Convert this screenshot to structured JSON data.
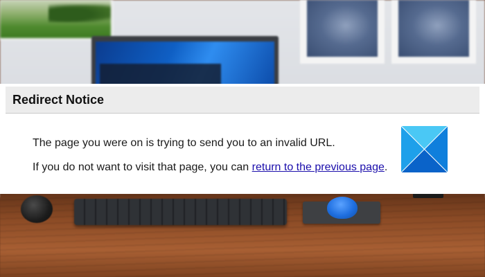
{
  "notice": {
    "title": "Redirect Notice",
    "line1": "The page you were on is trying to send you to an invalid URL.",
    "line2_prefix": "If you do not want to visit that page, you can ",
    "link_text": "return to the previous page",
    "line2_suffix": "."
  },
  "logo": {
    "icon": "windows-logo-icon",
    "colors": {
      "top": "#4ac8f5",
      "left": "#1ea0ea",
      "right": "#0f7fdc",
      "bottom": "#0a63c9",
      "lines": "#ffffff"
    }
  },
  "colors": {
    "header_background": "#ececec",
    "link": "#1a0dab"
  }
}
